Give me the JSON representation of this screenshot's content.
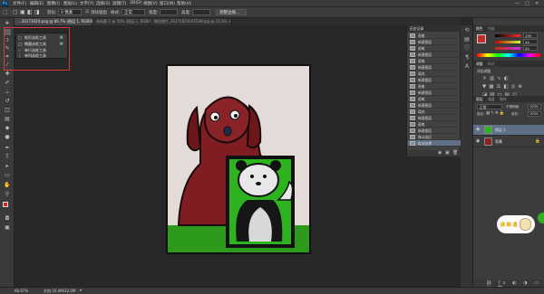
{
  "menubar": {
    "logo": "Ps",
    "items": [
      "文件(F)",
      "编辑(E)",
      "图像(I)",
      "图层(L)",
      "文字(Y)",
      "选择(S)",
      "滤镜(T)",
      "3D(D)",
      "视图(V)",
      "窗口(W)",
      "帮助(H)"
    ],
    "controls": [
      "—",
      "□",
      "✕"
    ]
  },
  "optbar": {
    "feather_label": "羽化:",
    "feather_value": "0 像素",
    "antialias_label": "消除锯齿",
    "style_label": "样式:",
    "style_value": "正常",
    "width_label": "宽度:",
    "height_label": "高度:",
    "refine_label": "调整边缘..."
  },
  "tabs": [
    {
      "label": "...20171024.png @ 66.7% (图层 1, RGB/8#) ×",
      "active": true
    },
    {
      "label": "未标题-1 @ 50% (图层 2, RGB/8) ×",
      "active": false
    },
    {
      "label": "微信图片_20171024165548.jpg @ 33.3% ×",
      "active": false
    }
  ],
  "flyout": {
    "items": [
      {
        "label": "矩形选框工具",
        "key": "M"
      },
      {
        "label": "椭圆选框工具",
        "key": "M"
      },
      {
        "label": "单行选框工具",
        "key": ""
      },
      {
        "label": "单列选框工具",
        "key": ""
      }
    ]
  },
  "history": {
    "title": "历史记录",
    "items": [
      {
        "label": "画笔"
      },
      {
        "label": "新建图层"
      },
      {
        "label": "画笔"
      },
      {
        "label": "新建图层"
      },
      {
        "label": "画笔"
      },
      {
        "label": "新建图层"
      },
      {
        "label": "填充"
      },
      {
        "label": "新建图层"
      },
      {
        "label": "画笔"
      },
      {
        "label": "新建图层"
      },
      {
        "label": "画笔"
      },
      {
        "label": "新建图层"
      },
      {
        "label": "填充"
      },
      {
        "label": "新建图层"
      },
      {
        "label": "画笔"
      },
      {
        "label": "新建图层"
      },
      {
        "label": "移动选区"
      },
      {
        "label": "取消选择"
      }
    ]
  },
  "panels": {
    "color_tabs": [
      "颜色",
      "色板"
    ],
    "color_values": [
      "199",
      "44",
      "44"
    ],
    "adjust_tabs": [
      "调整",
      "样式"
    ],
    "adjust_label": "添加调整",
    "layers_tabs": [
      "图层",
      "通道",
      "路径"
    ],
    "blend_mode": "正常",
    "opacity_label": "不透明度:",
    "opacity_value": "100%",
    "lock_label": "锁定:",
    "fill_label": "填充:",
    "fill_value": "100%",
    "layers": [
      {
        "name": "图层 1",
        "selected": true
      },
      {
        "name": "背景",
        "selected": false
      }
    ]
  },
  "status": {
    "zoom": "66.67%",
    "doc_info": "文档:16.0M/32.0M"
  },
  "badge": {
    "text": "顾 赐 遇"
  },
  "colors": {
    "accent_selection": "#5e6f86",
    "highlight_box": "#d9363e",
    "foreground_swatch": "#c72c2c",
    "background_swatch": "#f0d020"
  }
}
